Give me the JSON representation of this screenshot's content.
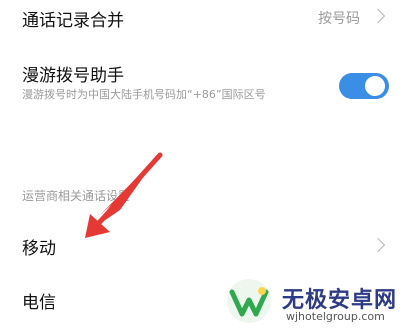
{
  "rows": [
    {
      "title": "通话记录合并",
      "value": "按号码"
    },
    {
      "title": "漫游拨号助手",
      "subtitle": "漫游拨号时为中国大陆手机号码加“+86”国际区号",
      "toggle_on": true
    },
    {
      "section_label": "运营商相关通话设置"
    },
    {
      "title": "移动"
    },
    {
      "title": "电信"
    }
  ],
  "watermark": {
    "name": "无极安卓网",
    "url": "wjhotelgroup.com"
  },
  "colors": {
    "accent": "#3a8ee6",
    "arrow": "#e53935"
  }
}
